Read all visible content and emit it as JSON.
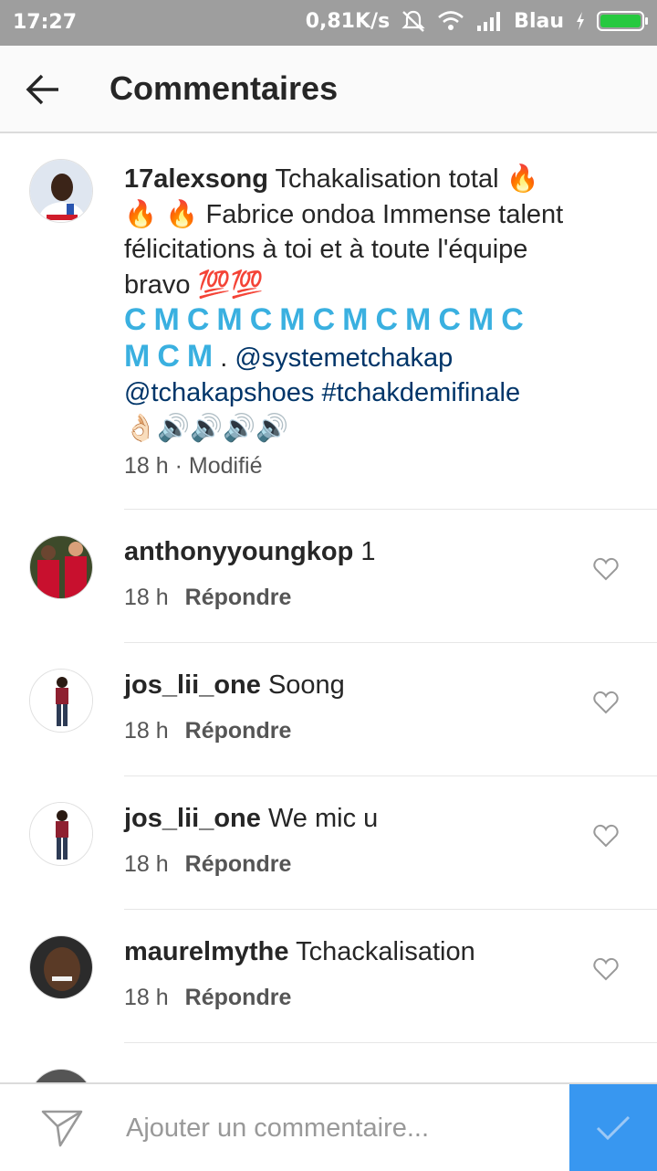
{
  "status_bar": {
    "time": "17:27",
    "speed": "0,81K/s",
    "carrier": "Blau",
    "icons": [
      "mute-icon",
      "wifi-icon",
      "signal-icon",
      "charging-icon",
      "battery-icon"
    ]
  },
  "header": {
    "title": "Commentaires",
    "back_icon": "arrow-left-icon"
  },
  "caption": {
    "username": "17alexsong",
    "text_1": " Tchakalisation total ",
    "emoji_fire_1": "🔥",
    "emoji_fire_2": "🔥 🔥",
    "text_2": " Fabrice ondoa Immense talent félicitations à toi et à toute l'équipe bravo ",
    "emoji_100": "💯💯",
    "decorative_line_1": "CMCMCMCMCMCMC",
    "decorative_line_2": "MCM",
    "dot": ". ",
    "mention_1": "@systemetchakap",
    "mention_2": "@tchakapshoes",
    "hashtag": "#tchakdemifinale",
    "emoji_tail": "👌🏻🔊🔊🔊🔊",
    "time": "18 h",
    "separator": " · ",
    "edited": "Modifié"
  },
  "comments": [
    {
      "username": "anthonyyoungkop",
      "text": "1",
      "time": "18 h",
      "reply_label": "Répondre"
    },
    {
      "username": "jos_lii_one",
      "text": "Soong",
      "time": "18 h",
      "reply_label": "Répondre"
    },
    {
      "username": "jos_lii_one",
      "text": "We mic u",
      "time": "18 h",
      "reply_label": "Répondre"
    },
    {
      "username": "maurelmythe",
      "text": "Tchackalisation",
      "time": "18 h",
      "reply_label": "Répondre"
    }
  ],
  "input": {
    "placeholder": "Ajouter un commentaire..."
  },
  "colors": {
    "accent": "#3897f0",
    "link": "#003569",
    "decorative": "#3ab0e0",
    "status_bar": "#9e9e9e"
  }
}
